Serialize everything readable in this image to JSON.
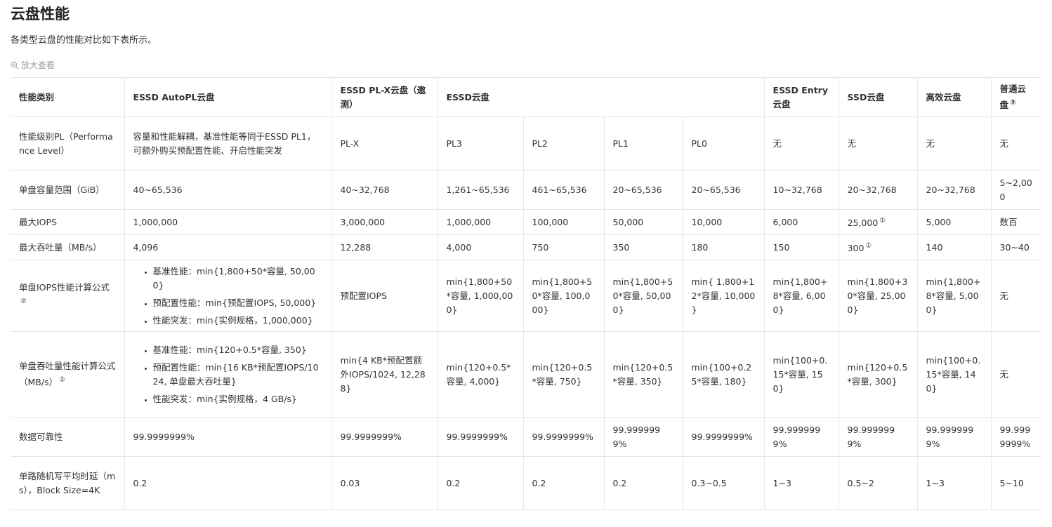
{
  "page": {
    "title": "云盘性能",
    "description": "各类型云盘的性能对比如下表所示。",
    "zoom_label": "放大查看"
  },
  "table": {
    "header": {
      "c0": "性能类别",
      "c1": "ESSD AutoPL云盘",
      "c2": "ESSD PL-X云盘（邀测）",
      "c3": "ESSD云盘",
      "c4": "ESSD Entry云盘",
      "c5": "SSD云盘",
      "c6": "高效云盘",
      "c7": "普通云盘",
      "c7_note": "③"
    },
    "level": {
      "label": "性能级别PL（Performance Level）",
      "autopl": "容量和性能解耦，基准性能等同于ESSD PL1，可额外购买预配置性能、开启性能突发",
      "plx": "PL-X",
      "pl3": "PL3",
      "pl2": "PL2",
      "pl1": "PL1",
      "pl0": "PL0",
      "entry": "无",
      "ssd": "无",
      "eff": "无",
      "basic": "无"
    },
    "capacity": {
      "label": "单盘容量范围（GiB）",
      "autopl": "40~65,536",
      "plx": "40~32,768",
      "pl3": "1,261~65,536",
      "pl2": "461~65,536",
      "pl1": "20~65,536",
      "pl0": "20~65,536",
      "entry": "10~32,768",
      "ssd": "20~32,768",
      "eff": "20~32,768",
      "basic": "5~2,000"
    },
    "iops": {
      "label": "最大IOPS",
      "autopl": "1,000,000",
      "plx": "3,000,000",
      "pl3": "1,000,000",
      "pl2": "100,000",
      "pl1": "50,000",
      "pl0": "10,000",
      "entry": "6,000",
      "ssd": "25,000",
      "ssd_note": "①",
      "eff": "5,000",
      "basic": "数百"
    },
    "throughput": {
      "label": "最大吞吐量（MB/s）",
      "autopl": "4,096",
      "plx": "12,288",
      "pl3": "4,000",
      "pl2": "750",
      "pl1": "350",
      "pl0": "180",
      "entry": "150",
      "ssd": "300",
      "ssd_note": "①",
      "eff": "140",
      "basic": "30~40"
    },
    "iops_formula": {
      "label": "单盘IOPS性能计算公式",
      "label_note": "②",
      "autopl": [
        "基准性能：min{1,800+50*容量, 50,000}",
        "预配置性能：min{预配置IOPS, 50,000}",
        "性能突发：min{实例规格，1,000,000}"
      ],
      "plx": "预配置IOPS",
      "pl3": "min{1,800+50*容量, 1,000,000}",
      "pl2": "min{1,800+50*容量, 100,000}",
      "pl1": "min{1,800+50*容量, 50,000}",
      "pl0": "min{ 1,800+12*容量, 10,000 }",
      "entry": "min{1,800+8*容量, 6,000}",
      "ssd": "min{1,800+30*容量, 25,000}",
      "eff": "min{1,800+8*容量, 5,000}",
      "basic": "无"
    },
    "tp_formula": {
      "label": "单盘吞吐量性能计算公式（MB/s）",
      "label_note": "②",
      "autopl": [
        "基准性能：min{120+0.5*容量, 350}",
        "预配置性能：min{16 KB*预配置IOPS/1024, 单盘最大吞吐量}",
        "性能突发：min{实例规格，4 GB/s}"
      ],
      "plx": "min{4 KB*预配置额外IOPS/1024, 12,288}",
      "pl3": "min{120+0.5*容量, 4,000}",
      "pl2": "min{120+0.5*容量, 750}",
      "pl1": "min{120+0.5*容量, 350}",
      "pl0": "min{100+0.25*容量, 180}",
      "entry": "min{100+0.15*容量, 150}",
      "ssd": "min{120+0.5*容量, 300}",
      "eff": "min{100+0.15*容量, 140}",
      "basic": "无"
    },
    "reliability": {
      "label": "数据可靠性",
      "autopl": "99.9999999%",
      "plx": "99.9999999%",
      "pl3": "99.9999999%",
      "pl2": "99.9999999%",
      "pl1": "99.9999999%",
      "pl0": "99.9999999%",
      "entry": "99.9999999%",
      "ssd": "99.9999999%",
      "eff": "99.9999999%",
      "basic": "99.9999999%"
    },
    "latency": {
      "label": "单路随机写平均时延（ms），Block Size=4K",
      "autopl": "0.2",
      "plx": "0.03",
      "pl3": "0.2",
      "pl2": "0.2",
      "pl1": "0.2",
      "pl0": "0.3~0.5",
      "entry": "1~3",
      "ssd": "0.5~2",
      "eff": "1~3",
      "basic": "5~10"
    }
  }
}
